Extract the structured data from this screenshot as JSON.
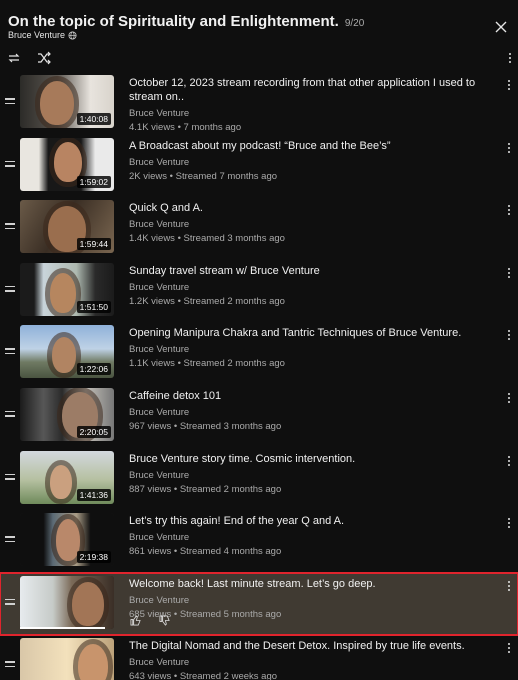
{
  "playlist": {
    "title": "On the topic of Spirituality and Enlightenment.",
    "position": "9/20",
    "owner": "Bruce Venture"
  },
  "icons": {
    "close": "close-icon",
    "loop": "loop-icon",
    "shuffle": "shuffle-icon",
    "more": "more-vert-icon",
    "globe": "globe-icon",
    "handle": "drag-handle-icon",
    "like": "thumbs-up-icon",
    "dislike": "thumbs-down-icon"
  },
  "colors": {
    "background": "#0f0f0f",
    "active_bg": "#403a32",
    "active_border": "#e0242d"
  },
  "videos": [
    {
      "title": "October 12, 2023 stream recording from that other application I used to stream on..",
      "channel": "Bruce Venture",
      "meta": "4.1K views • 7 months ago",
      "duration": "1:40:08"
    },
    {
      "title": "A Broadcast about my podcast! “Bruce and the Bee’s”",
      "channel": "Bruce Venture",
      "meta": "2K views • Streamed 7 months ago",
      "duration": "1:59:02"
    },
    {
      "title": "Quick Q and A.",
      "channel": "Bruce Venture",
      "meta": "1.4K views • Streamed 3 months ago",
      "duration": "1:59:44"
    },
    {
      "title": "Sunday travel stream w/ Bruce Venture",
      "channel": "Bruce Venture",
      "meta": "1.2K views • Streamed 2 months ago",
      "duration": "1:51:50"
    },
    {
      "title": "Opening Manipura Chakra and Tantric Techniques of Bruce Venture.",
      "channel": "Bruce Venture",
      "meta": "1.1K views • Streamed 2 months ago",
      "duration": "1:22:06"
    },
    {
      "title": "Caffeine detox 101",
      "channel": "Bruce Venture",
      "meta": "967 views • Streamed 3 months ago",
      "duration": "2:20:05"
    },
    {
      "title": "Bruce Venture story time. Cosmic intervention.",
      "channel": "Bruce Venture",
      "meta": "887 views • Streamed 2 months ago",
      "duration": "1:41:36"
    },
    {
      "title": "Let’s try this again! End of the year Q and A.",
      "channel": "Bruce Venture",
      "meta": "861 views • Streamed 4 months ago",
      "duration": "2:19:38"
    },
    {
      "title": "Welcome back! Last minute stream. Let’s go deep.",
      "channel": "Bruce Venture",
      "meta": "685 views • Streamed 5 months ago",
      "duration": "",
      "active": true,
      "watch_progress": 0.9
    },
    {
      "title": "The Digital Nomad and the Desert Detox. Inspired by true life events.",
      "channel": "Bruce Venture",
      "meta": "643 views • Streamed 2 weeks ago",
      "duration": ""
    }
  ]
}
